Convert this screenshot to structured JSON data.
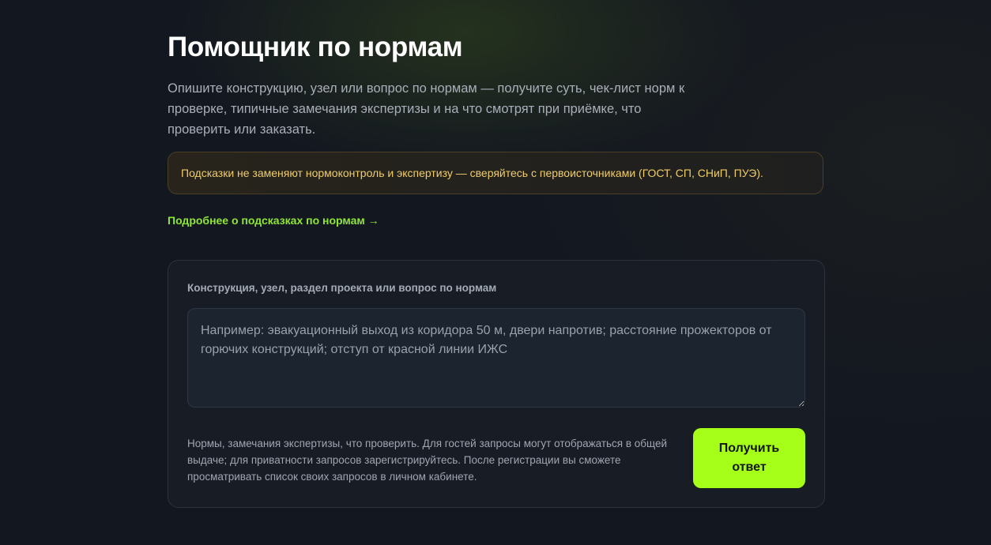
{
  "header": {
    "title": "Помощник по нормам",
    "subtitle": "Опишите конструкцию, узел или вопрос по нормам — получите суть, чек-лист норм к проверке, типичные замечания экспертизы и на что смотрят при приёмке, что проверить или заказать."
  },
  "notice": {
    "text": "Подсказки не заменяют нормоконтроль и экспертизу — сверяйтесь с первоисточниками (ГОСТ, СП, СНиП, ПУЭ).",
    "text_color": "#f0cd6a"
  },
  "more_link": {
    "label": "Подробнее о подсказках по нормам →",
    "color": "#8fe635"
  },
  "form": {
    "label": "Конструкция, узел, раздел проекта или вопрос по нормам",
    "value": "",
    "placeholder": "Например: эвакуационный выход из коридора 50 м, двери напротив; расстояние прожекторов от горючих конструкций; отступ от красной линии ИЖС",
    "hint": "Нормы, замечания экспертизы, что проверить. Для гостей запросы могут отображаться в общей выдаче; для приватности запросов зарегистрируйтесь. После регистрации вы сможете просматривать список своих запросов в личном кабинете.",
    "submit_label": "Получить ответ",
    "submit_color": "#a6ff18"
  }
}
